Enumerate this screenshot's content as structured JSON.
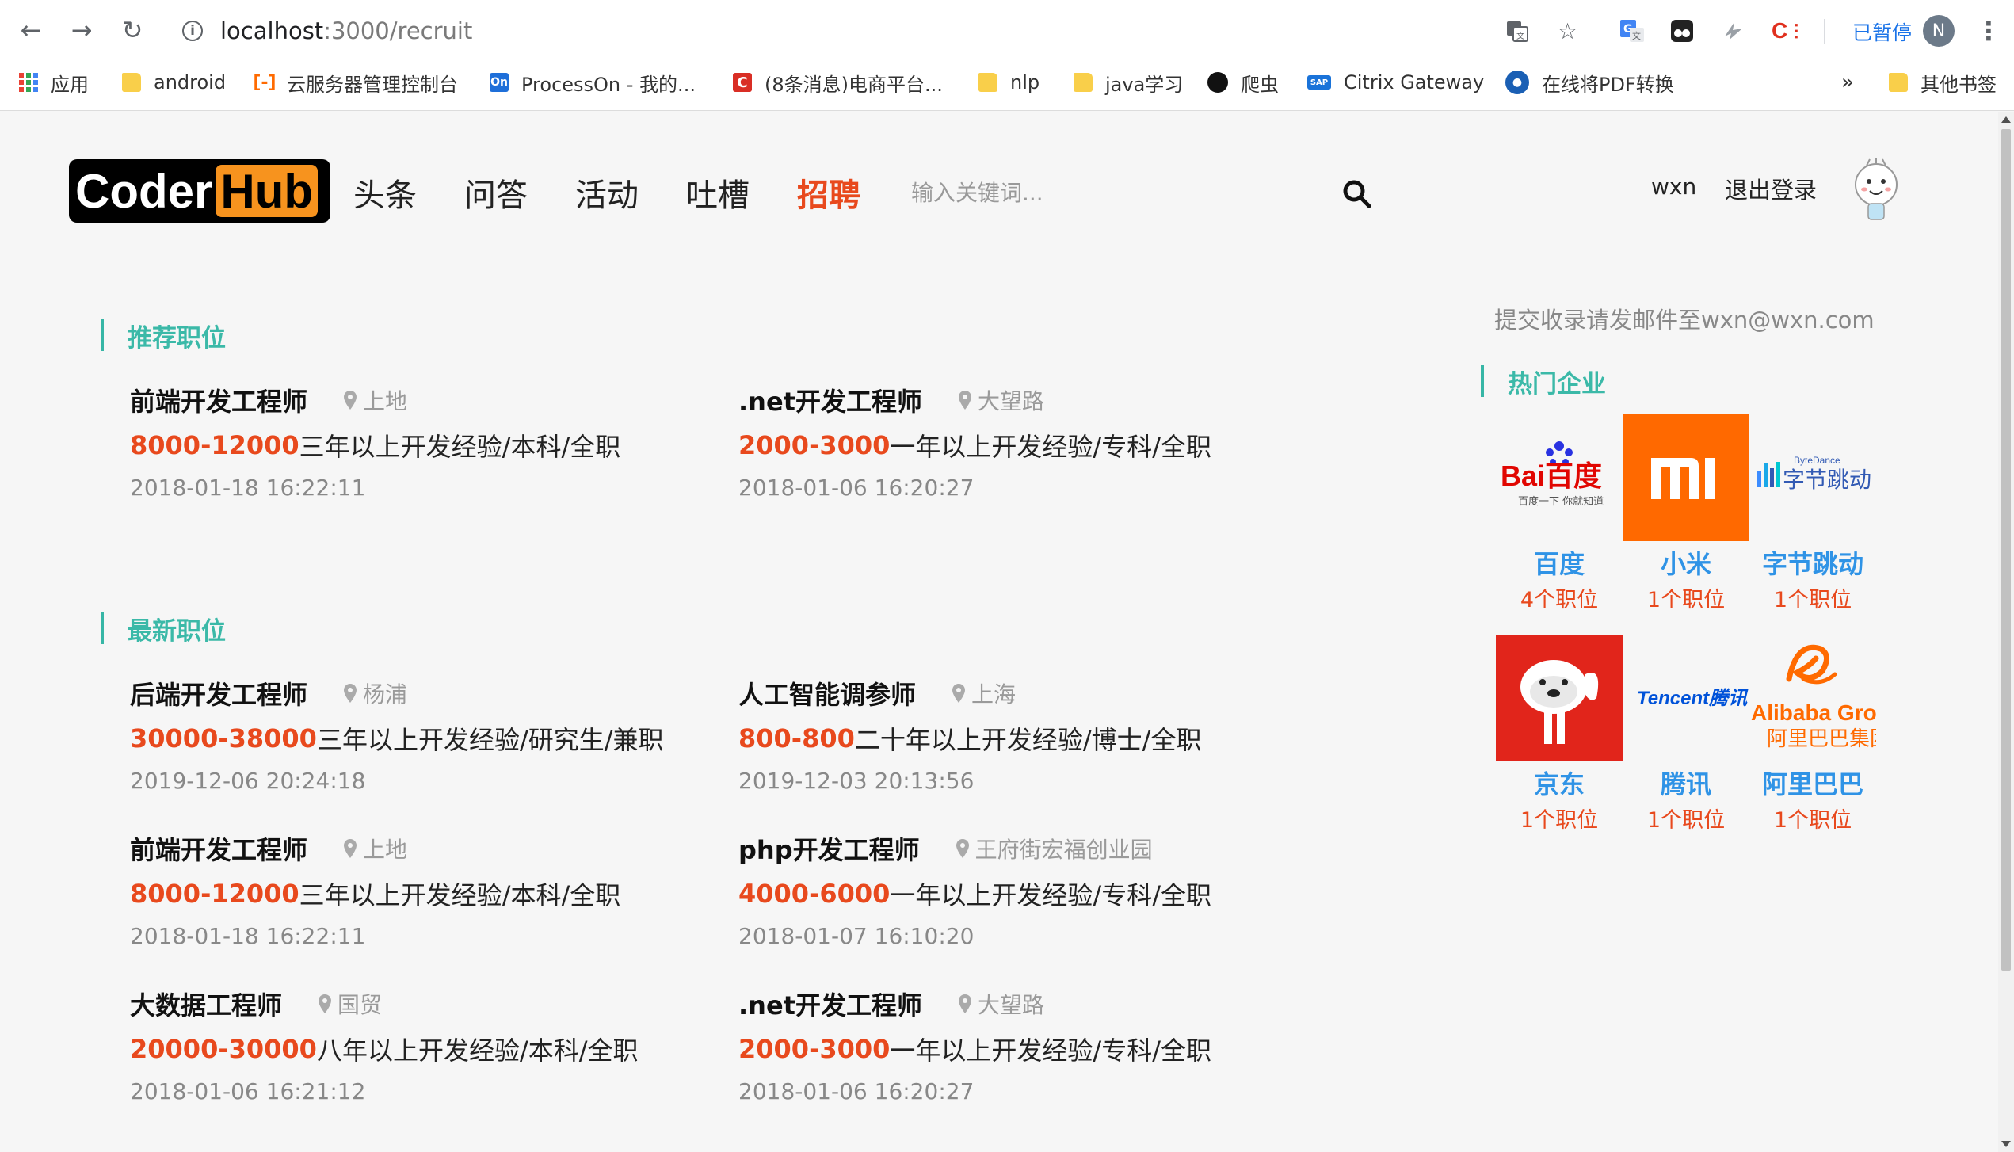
{
  "browser": {
    "url_host": "localhost",
    "url_path": ":3000/recruit",
    "paused_label": "已暂停",
    "profile_initial": "N",
    "bookmarks": [
      {
        "label": "应用",
        "icon": "apps-icon"
      },
      {
        "label": "android",
        "icon": "folder-icon"
      },
      {
        "label": "云服务器管理控制台",
        "icon": "aliyun-icon"
      },
      {
        "label": "ProcessOn - 我的...",
        "icon": "processon-icon"
      },
      {
        "label": "(8条消息)电商平台...",
        "icon": "csdn-icon"
      },
      {
        "label": "nlp",
        "icon": "folder-icon"
      },
      {
        "label": "java学习",
        "icon": "folder-icon"
      },
      {
        "label": "爬虫",
        "icon": "github-icon"
      },
      {
        "label": "Citrix Gateway",
        "icon": "sap-icon"
      },
      {
        "label": "在线将PDF转换",
        "icon": "pdf-icon"
      }
    ],
    "overflow_label": "»",
    "other_bookmarks": "其他书签"
  },
  "header": {
    "logo_left": "Coder",
    "logo_right": "Hub",
    "nav": [
      "头条",
      "问答",
      "活动",
      "吐槽",
      "招聘"
    ],
    "active_nav": "招聘",
    "search_placeholder": "输入关键词...",
    "username": "wxn",
    "logout_label": "退出登录"
  },
  "recommended": {
    "title": "推荐职位",
    "jobs": [
      {
        "title": "前端开发工程师",
        "location": "上地",
        "salary": "8000-12000",
        "requirements": "三年以上开发经验/本科/全职",
        "date": "2018-01-18 16:22:11"
      },
      {
        "title": ".net开发工程师",
        "location": "大望路",
        "salary": "2000-3000",
        "requirements": "一年以上开发经验/专科/全职",
        "date": "2018-01-06 16:20:27"
      }
    ]
  },
  "latest": {
    "title": "最新职位",
    "jobs": [
      {
        "title": "后端开发工程师",
        "location": "杨浦",
        "salary": "30000-38000",
        "requirements": "三年以上开发经验/研究生/兼职",
        "date": "2019-12-06 20:24:18"
      },
      {
        "title": "人工智能调参师",
        "location": "上海",
        "salary": "800-800",
        "requirements": "二十年以上开发经验/博士/全职",
        "date": "2019-12-03 20:13:56"
      },
      {
        "title": "前端开发工程师",
        "location": "上地",
        "salary": "8000-12000",
        "requirements": "三年以上开发经验/本科/全职",
        "date": "2018-01-18 16:22:11"
      },
      {
        "title": "php开发工程师",
        "location": "王府街宏福创业园",
        "salary": "4000-6000",
        "requirements": "一年以上开发经验/专科/全职",
        "date": "2018-01-07 16:10:20"
      },
      {
        "title": "大数据工程师",
        "location": "国贸",
        "salary": "20000-30000",
        "requirements": "八年以上开发经验/本科/全职",
        "date": "2018-01-06 16:21:12"
      },
      {
        "title": ".net开发工程师",
        "location": "大望路",
        "salary": "2000-3000",
        "requirements": "一年以上开发经验/专科/全职",
        "date": "2018-01-06 16:20:27"
      }
    ]
  },
  "sidebar": {
    "submit_note": "提交收录请发邮件至wxn@wxn.com",
    "hot_title": "热门企业",
    "companies": [
      {
        "name": "百度",
        "count": "4个职位",
        "logo_text": "Bai百度",
        "logo_sub": "百度一下 你就知道"
      },
      {
        "name": "小米",
        "count": "1个职位",
        "logo_text": "mi"
      },
      {
        "name": "字节跳动",
        "count": "1个职位",
        "logo_text": "字节跳动",
        "logo_sub": "ByteDance"
      },
      {
        "name": "京东",
        "count": "1个职位"
      },
      {
        "name": "腾讯",
        "count": "1个职位",
        "logo_text": "Tencent腾讯"
      },
      {
        "name": "阿里巴巴",
        "count": "1个职位",
        "logo_text": "Alibaba Group",
        "logo_sub": "阿里巴巴集团"
      }
    ]
  },
  "colors": {
    "accent_teal": "#3bb9a8",
    "accent_red": "#e8491d",
    "company_blue": "#2f93e6"
  }
}
